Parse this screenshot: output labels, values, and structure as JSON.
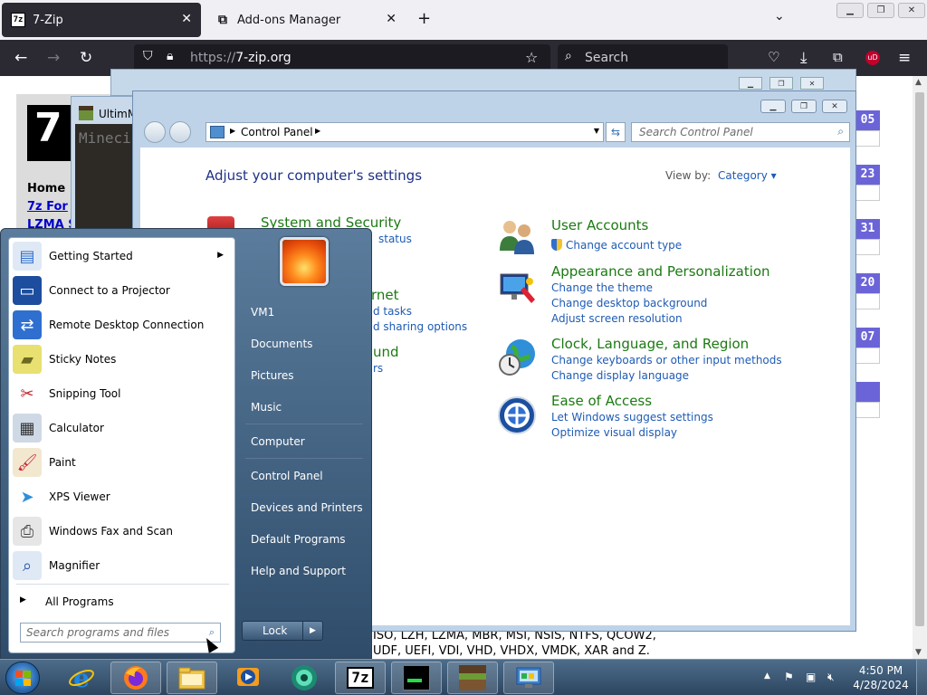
{
  "browser": {
    "tabs": [
      {
        "label": "7-Zip",
        "favicon": "7z"
      },
      {
        "label": "Add-ons Manager"
      }
    ],
    "url_scheme": "https://",
    "url_host": "7-zip.org",
    "search_placeholder": "Search"
  },
  "site": {
    "logo": "7",
    "nav": [
      "Home",
      "7z For",
      "LZMA S"
    ],
    "date_badges": [
      "05",
      "23",
      "31",
      "20",
      "07"
    ],
    "bottom_text_line1": "ISO, LZH, LZMA, MBR, MSI, NSIS, NTFS, QCOW2,",
    "bottom_text_line2": "UDF, UEFI, VDI, VHD, VHDX, VMDK, XAR and Z."
  },
  "minecraft_window": {
    "title": "UltimM",
    "body_text": "Mineci"
  },
  "control_panel": {
    "breadcrumb": "Control Panel",
    "search_placeholder": "Search Control Panel",
    "heading": "Adjust your computer's settings",
    "view_by_label": "View by:",
    "view_by_value": "Category",
    "categories": [
      {
        "title": "System and Security",
        "links": [
          "status"
        ]
      },
      {
        "title": "rnet",
        "links": [
          "d tasks",
          "d sharing options"
        ]
      },
      {
        "title": "und",
        "links": [
          "rs"
        ]
      },
      {
        "title": "User Accounts",
        "links": [
          "Change account type"
        ]
      },
      {
        "title": "Appearance and Personalization",
        "links": [
          "Change the theme",
          "Change desktop background",
          "Adjust screen resolution"
        ]
      },
      {
        "title": "Clock, Language, and Region",
        "links": [
          "Change keyboards or other input methods",
          "Change display language"
        ]
      },
      {
        "title": "Ease of Access",
        "links": [
          "Let Windows suggest settings",
          "Optimize visual display"
        ]
      }
    ]
  },
  "start_menu": {
    "programs": [
      {
        "label": "Getting Started",
        "icon": "getting-started-icon",
        "has_submenu": true
      },
      {
        "label": "Connect to a Projector",
        "icon": "projector-icon"
      },
      {
        "label": "Remote Desktop Connection",
        "icon": "remote-desktop-icon"
      },
      {
        "label": "Sticky Notes",
        "icon": "sticky-notes-icon"
      },
      {
        "label": "Snipping Tool",
        "icon": "scissors-icon"
      },
      {
        "label": "Calculator",
        "icon": "calculator-icon"
      },
      {
        "label": "Paint",
        "icon": "paint-icon"
      },
      {
        "label": "XPS Viewer",
        "icon": "xps-icon"
      },
      {
        "label": "Windows Fax and Scan",
        "icon": "fax-icon"
      },
      {
        "label": "Magnifier",
        "icon": "magnifier-icon"
      }
    ],
    "all_programs": "All Programs",
    "search_placeholder": "Search programs and files",
    "right_items": [
      "VM1",
      "Documents",
      "Pictures",
      "Music",
      "Computer",
      "Control Panel",
      "Devices and Printers",
      "Default Programs",
      "Help and Support"
    ],
    "lock_label": "Lock"
  },
  "taskbar": {
    "items": [
      "internet-explorer-icon",
      "firefox-icon",
      "explorer-icon",
      "media-player-icon",
      "app-icon",
      "7zip-icon",
      "terminal-icon",
      "minecraft-icon",
      "control-panel-icon"
    ],
    "time": "4:50 PM",
    "date": "4/28/2024"
  }
}
